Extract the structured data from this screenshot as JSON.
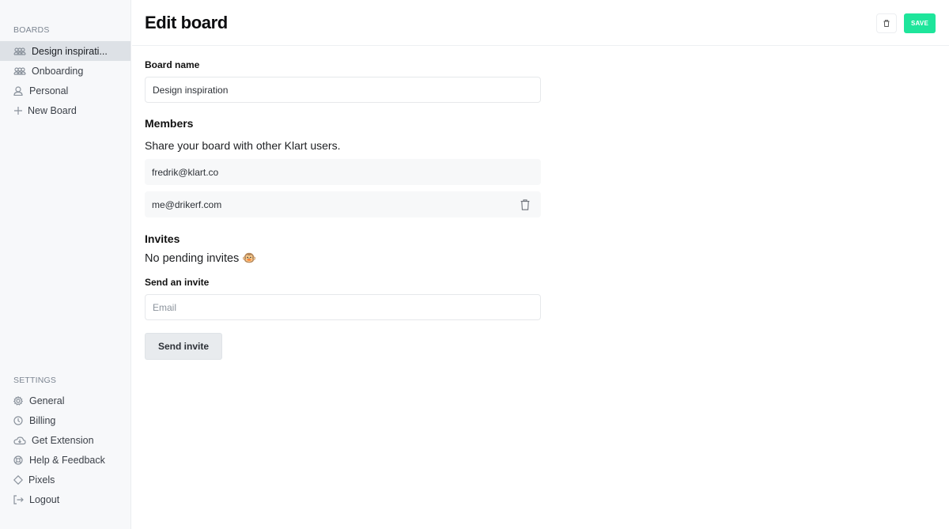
{
  "sidebar": {
    "boards_title": "BOARDS",
    "boards": [
      {
        "label": "Design inspirati...",
        "icon": "group-icon",
        "active": true
      },
      {
        "label": "Onboarding",
        "icon": "group-icon",
        "active": false
      },
      {
        "label": "Personal",
        "icon": "user-icon",
        "active": false
      },
      {
        "label": "New Board",
        "icon": "plus-icon",
        "active": false
      }
    ],
    "settings_title": "SETTINGS",
    "settings": [
      {
        "label": "General",
        "icon": "gear-icon"
      },
      {
        "label": "Billing",
        "icon": "clock-icon"
      },
      {
        "label": "Get Extension",
        "icon": "cloud-download-icon"
      },
      {
        "label": "Help & Feedback",
        "icon": "lifebuoy-icon"
      },
      {
        "label": "Pixels",
        "icon": "diamond-icon"
      },
      {
        "label": "Logout",
        "icon": "logout-icon"
      }
    ]
  },
  "header": {
    "title": "Edit board",
    "save_label": "SAVE",
    "accent_color": "#1ee59b"
  },
  "form": {
    "board_name_label": "Board name",
    "board_name_value": "Design inspiration",
    "members_heading": "Members",
    "members_description": "Share your board with other Klart users.",
    "members": [
      {
        "email": "fredrik@klart.co",
        "removable": false
      },
      {
        "email": "me@drikerf.com",
        "removable": true
      }
    ],
    "invites_heading": "Invites",
    "invites_status": "No pending invites 🐵",
    "send_invite_label": "Send an invite",
    "email_placeholder": "Email",
    "email_value": "",
    "send_invite_button": "Send invite"
  }
}
